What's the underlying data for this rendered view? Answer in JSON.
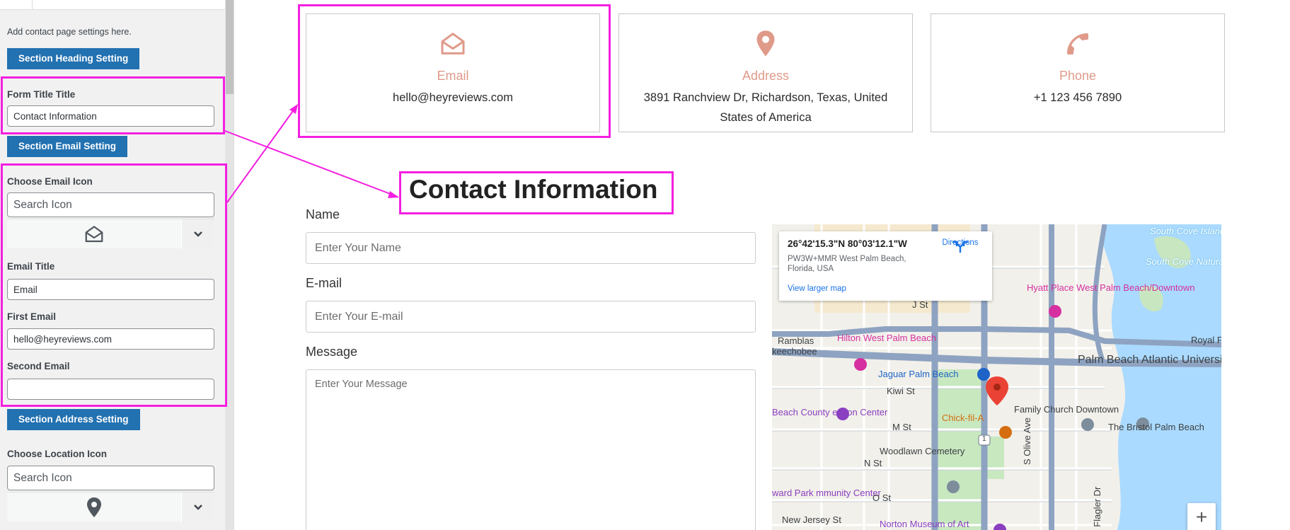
{
  "sidebar": {
    "description": "Add contact page settings here.",
    "heading_button": "Section Heading Setting",
    "form_title_label": "Form Title Title",
    "form_title_value": "Contact Information",
    "email_button": "Section Email Setting",
    "email_icon_label": "Choose Email Icon",
    "search_icon_placeholder": "Search Icon",
    "email_title_label": "Email Title",
    "email_title_value": "Email",
    "first_email_label": "First Email",
    "first_email_value": "hello@heyreviews.com",
    "second_email_label": "Second Email",
    "second_email_value": "",
    "address_button": "Section Address Setting",
    "location_icon_label": "Choose Location Icon",
    "location_search_placeholder": "Search Icon"
  },
  "cards": {
    "email": {
      "title": "Email",
      "text": "hello@heyreviews.com",
      "icon": "envelope-open-icon"
    },
    "address": {
      "title": "Address",
      "text": "3891 Ranchview Dr, Richardson, Texas, United States of America",
      "icon": "map-pin-icon"
    },
    "phone": {
      "title": "Phone",
      "text": "+1 123 456 7890",
      "icon": "phone-icon"
    }
  },
  "form": {
    "heading": "Contact Information",
    "name_label": "Name",
    "name_placeholder": "Enter Your Name",
    "email_label": "E-mail",
    "email_placeholder": "Enter Your E-mail",
    "message_label": "Message",
    "message_placeholder": "Enter Your Message"
  },
  "map": {
    "coords": "26°42'15.3\"N 80°03'12.1\"W",
    "address": "PW3W+MMR West Palm Beach, Florida, USA",
    "directions": "Directions",
    "larger_map": "View larger map",
    "zoom_in": "+",
    "labels": {
      "south_cove_islands": "South Cove Islands",
      "south_cove_area": "South Cove Natural Area",
      "hyatt": "Hyatt Place West Palm Beach/Downtown",
      "hilton": "Hilton West Palm Beach",
      "jaguar": "Jaguar Palm Beach",
      "palm_beach_atlantic": "Palm Beach Atlantic University",
      "convention": "Beach County ention Center",
      "kiwi": "Kiwi St",
      "chick": "Chick-fil-A",
      "family_church": "Family Church Downtown",
      "bristol": "The Bristol Palm Beach",
      "m_st": "M St",
      "woodlawn": "Woodlawn Cemetery",
      "n_st": "N St",
      "o_st": "O St",
      "ward_park": "ward Park mmunity Center",
      "new_jersey": "New Jersey St",
      "norton": "Norton Museum of Art",
      "j_st": "J St",
      "ramblas": "Ramblas",
      "keechobee": "keechobee",
      "royal": "Royal P",
      "olive": "S Olive Ave",
      "flagler": "S Flagler Dr",
      "highway": "1"
    }
  },
  "colors": {
    "accent_salmon": "#e09a8a",
    "wp_button": "#2271b1",
    "annotation": "#f41fe0",
    "map_pin": "#ea4335"
  }
}
